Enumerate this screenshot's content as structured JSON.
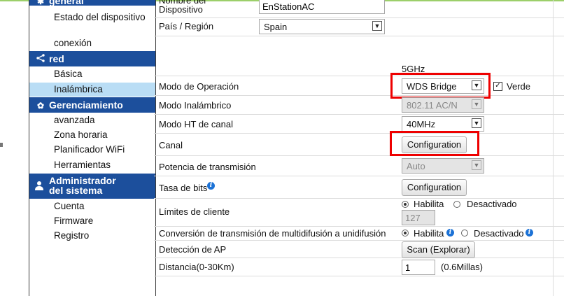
{
  "sidebar": {
    "sections": [
      {
        "label": "general",
        "icon": "settings-icon"
      },
      {
        "label": "red",
        "icon": "share-icon"
      },
      {
        "label": "Gerenciamiento",
        "icon": "gear-icon"
      },
      {
        "label": "Administrador del sistema",
        "icon": "user-icon"
      }
    ],
    "items": {
      "estado": "Estado del dispositivo",
      "conexion": "conexión",
      "basica": "Básica",
      "inalambrica": "Inalámbrica",
      "avanzada": "avanzada",
      "zona": "Zona horaria",
      "planificador": "Planificador WiFi",
      "herramientas": "Herramientas",
      "cuenta": "Cuenta",
      "firmware": "Firmware",
      "registro": "Registro"
    },
    "admin_line1": "Administrador",
    "admin_line2": "del sistema"
  },
  "device": {
    "name_label": "Nombre del Dispositivo",
    "name_value": "EnStationAC",
    "country_label": "País / Región",
    "country_value": "Spain"
  },
  "wireless": {
    "band_header": "5GHz",
    "mode_label": "Modo de Operación",
    "mode_value": "WDS Bridge",
    "green_label": "Verde",
    "wmode_label": "Modo Inalámbrico",
    "wmode_value": "802.11 AC/N",
    "ht_label": "Modo HT de canal",
    "ht_value": "40MHz",
    "channel_label": "Canal",
    "channel_button": "Configuration",
    "power_label": "Potencia de transmisión",
    "power_value": "Auto",
    "bitrate_label": "Tasa de bits",
    "bitrate_button": "Configuration",
    "clients_label": "Límites de cliente",
    "enable_label": "Habilita",
    "disable_label": "Desactivado",
    "clients_value": "127",
    "multicast_label": "Conversión de transmisión de multidifusión a unidifusión",
    "ap_label": "Detección de AP",
    "scan_button": "Scan (Explorar)",
    "distance_label": "Distancia(0-30Km)",
    "distance_value": "1",
    "distance_miles": "(0.6Millas)"
  }
}
